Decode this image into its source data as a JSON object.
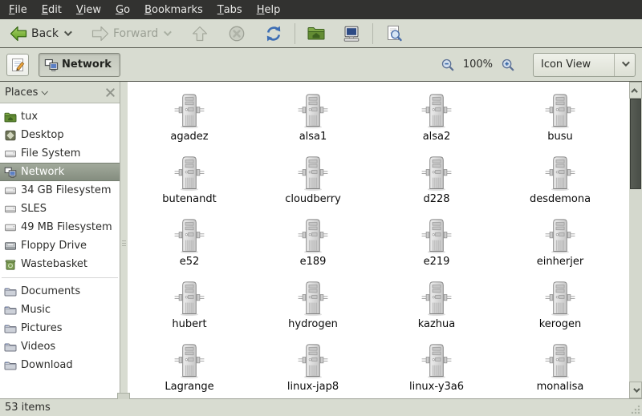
{
  "menubar": {
    "items": [
      {
        "mnemonic": "F",
        "rest": "ile"
      },
      {
        "mnemonic": "E",
        "rest": "dit"
      },
      {
        "mnemonic": "V",
        "rest": "iew"
      },
      {
        "mnemonic": "G",
        "rest": "o"
      },
      {
        "mnemonic": "B",
        "rest": "ookmarks"
      },
      {
        "mnemonic": "T",
        "rest": "abs"
      },
      {
        "mnemonic": "H",
        "rest": "elp"
      }
    ]
  },
  "toolbar": {
    "back": {
      "label": "Back",
      "enabled": true,
      "icon": "back-arrow-icon"
    },
    "forward": {
      "label": "Forward",
      "enabled": false,
      "icon": "forward-arrow-icon"
    },
    "up": {
      "enabled": false,
      "icon": "up-arrow-icon"
    },
    "stop": {
      "enabled": false,
      "icon": "stop-icon"
    },
    "reload": {
      "enabled": true,
      "icon": "reload-icon"
    },
    "home": {
      "enabled": true,
      "icon": "home-folder-icon"
    },
    "computer": {
      "enabled": true,
      "icon": "computer-icon"
    },
    "search": {
      "enabled": true,
      "icon": "search-icon"
    }
  },
  "locationbar": {
    "edit_location_icon": "edit-location-icon",
    "path_button_label": "Network",
    "path_button_icon": "network-icon",
    "zoom_out_icon": "zoom-out-icon",
    "zoom_level": "100%",
    "zoom_in_icon": "zoom-in-icon",
    "view_selector_value": "Icon View"
  },
  "sidebar": {
    "header": "Places",
    "close_icon": "close-icon",
    "items": [
      {
        "label": "tux",
        "icon": "home-folder"
      },
      {
        "label": "Desktop",
        "icon": "desktop"
      },
      {
        "label": "File System",
        "icon": "drive"
      },
      {
        "label": "Network",
        "icon": "network",
        "selected": true
      },
      {
        "label": "34 GB Filesystem",
        "icon": "drive"
      },
      {
        "label": "SLES",
        "icon": "drive"
      },
      {
        "label": "49 MB Filesystem",
        "icon": "drive"
      },
      {
        "label": "Floppy Drive",
        "icon": "floppy"
      },
      {
        "label": "Wastebasket",
        "icon": "trash"
      },
      {
        "separator": true
      },
      {
        "label": "Documents",
        "icon": "folder"
      },
      {
        "label": "Music",
        "icon": "folder"
      },
      {
        "label": "Pictures",
        "icon": "folder"
      },
      {
        "label": "Videos",
        "icon": "folder"
      },
      {
        "label": "Download",
        "icon": "folder"
      }
    ]
  },
  "content": {
    "server_icon": "network-server-icon",
    "servers": [
      "agadez",
      "alsa1",
      "alsa2",
      "busu",
      "butenandt",
      "cloudberry",
      "d228",
      "desdemona",
      "e52",
      "e189",
      "e219",
      "einherjer",
      "hubert",
      "hydrogen",
      "kazhua",
      "kerogen",
      "Lagrange",
      "linux-jap8",
      "linux-y3a6",
      "monalisa"
    ]
  },
  "statusbar": {
    "text": "53 items"
  },
  "colors": {
    "menubar_bg": "#323230",
    "panel_bg": "#d8dcd1",
    "selection_bg": "#8d978a",
    "back_arrow_green": "#6fae2b",
    "reload_blue": "#3d6eb4",
    "scroll_thumb": "#4b5049"
  }
}
